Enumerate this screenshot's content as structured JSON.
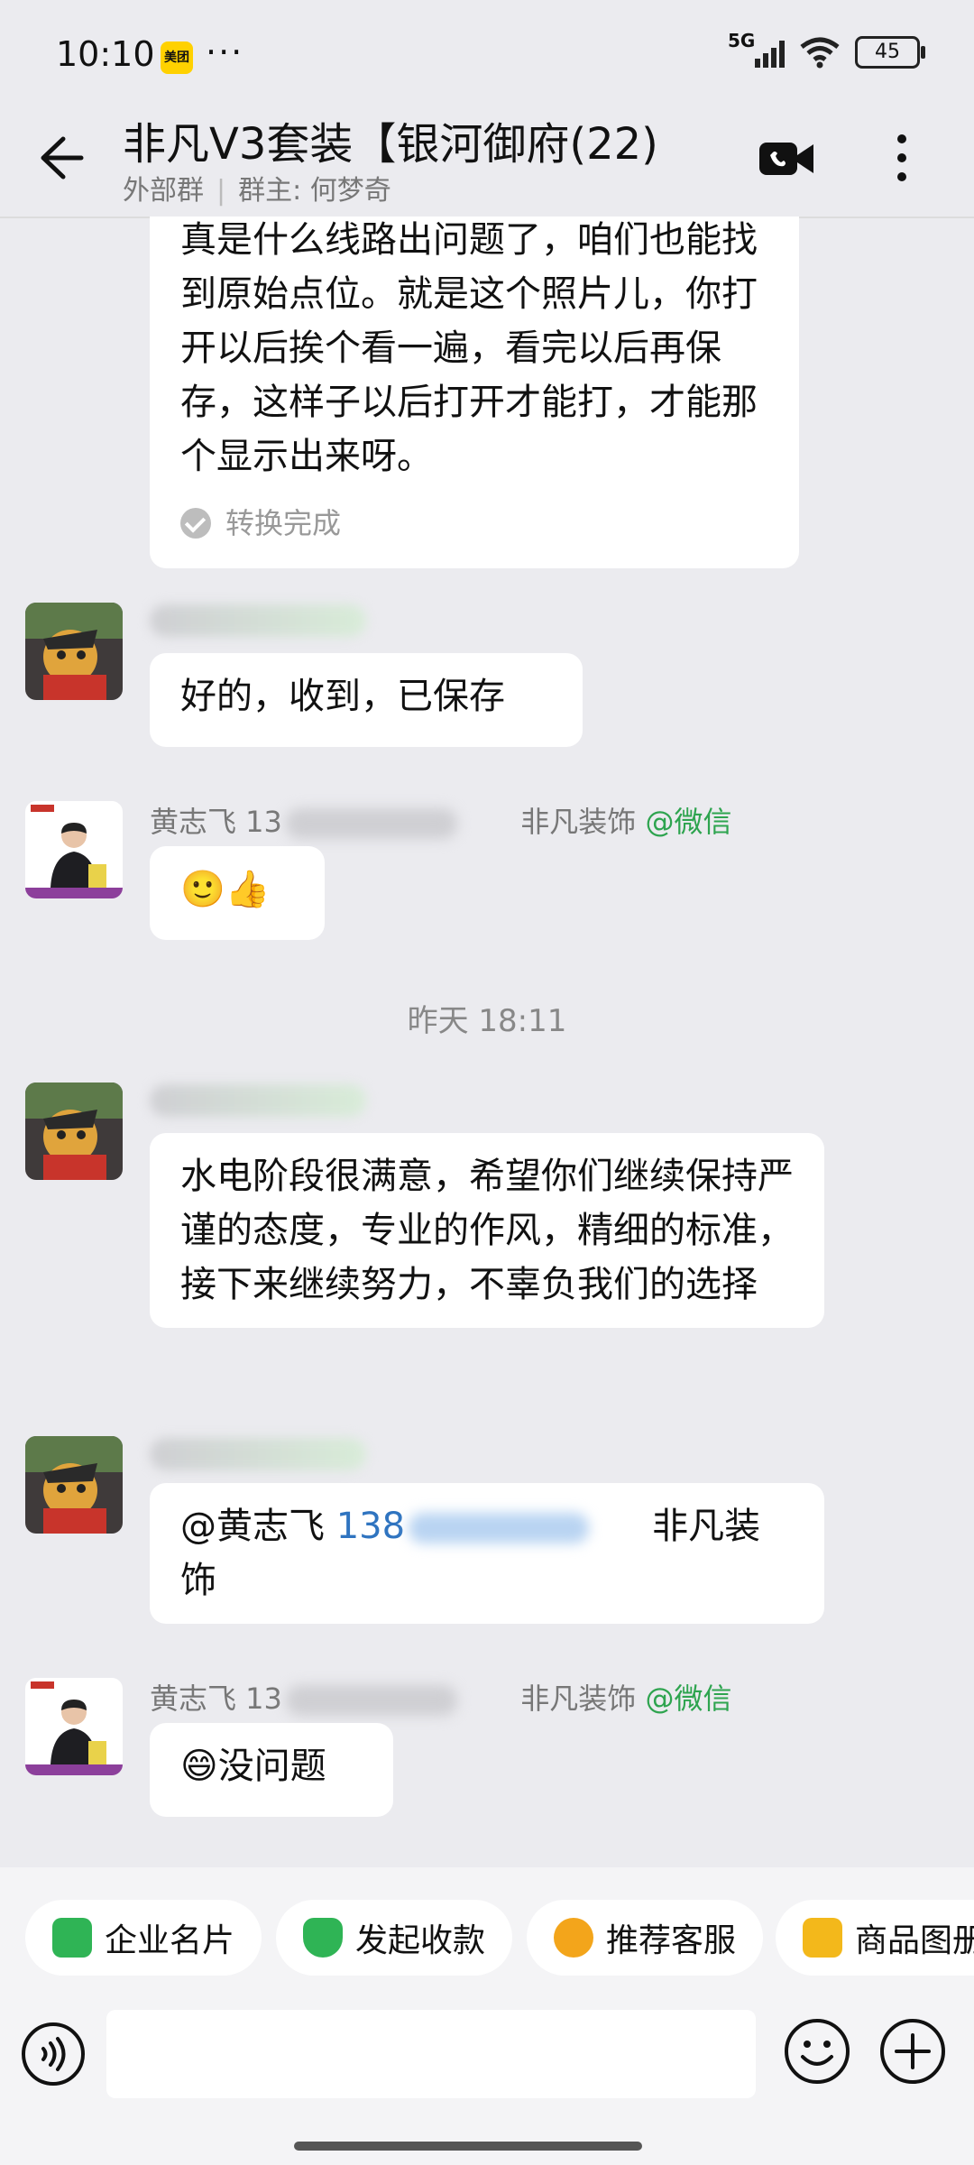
{
  "status_bar": {
    "time": "10:10",
    "app_badge": "美团",
    "more": "···",
    "network": "5G",
    "battery": "45"
  },
  "header": {
    "title": "非凡V3套装【银河御府(22)",
    "group_type": "外部群",
    "owner": "群主: 何梦奇"
  },
  "messages": {
    "m1": {
      "text": "真是什么线路出问题了，咱们也能找到原始点位。就是这个照片儿，你打开以后挨个看一遍，看完以后再保存，这样子以后打开才能打，才能那个显示出来呀。",
      "status": "转换完成"
    },
    "m2": {
      "text": "好的，收到，已保存"
    },
    "m3": {
      "sender": "黄志飞 13",
      "company": "非凡装饰",
      "source": "@微信",
      "text": "🙂👍"
    },
    "time_divider": "昨天   18:11",
    "m4": {
      "text": "水电阶段很满意，希望你们继续保持严谨的态度，专业的作风，精细的标准，接下来继续努力，不辜负我们的选择"
    },
    "m5": {
      "mention": "@黄志飞 ",
      "number": "138",
      "company": "非凡装饰"
    },
    "m6": {
      "sender": "黄志飞 13",
      "company": "非凡装饰",
      "source": "@微信",
      "text": "😄没问题"
    }
  },
  "quick_actions": [
    "企业名片",
    "发起收款",
    "推荐客服",
    "商品图册"
  ],
  "colors": {
    "background": "#ebebef",
    "accent_green": "#2ea44f",
    "link_blue": "#2f74c0"
  }
}
